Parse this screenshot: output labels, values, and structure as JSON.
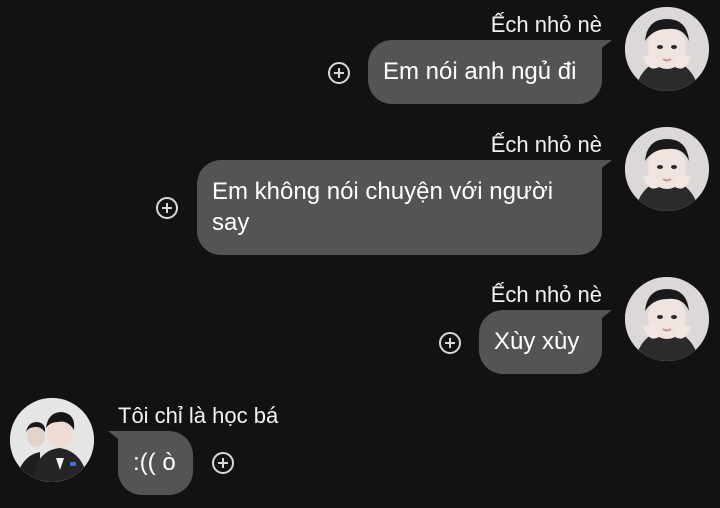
{
  "messages": [
    {
      "sender": "Ếch nhỏ nè",
      "text": "Em nói anh ngủ đi",
      "side": "right"
    },
    {
      "sender": "Ếch nhỏ nè",
      "text": "Em không nói chuyện với người say",
      "side": "right"
    },
    {
      "sender": "Ếch nhỏ nè",
      "text": "Xùy xùy",
      "side": "right"
    },
    {
      "sender": "Tôi chỉ là học bá",
      "text": ":(( ò",
      "side": "left"
    }
  ],
  "colors": {
    "background": "#121212",
    "bubble": "#545454",
    "text": "#ffffff",
    "icon": "#d9d9d9"
  },
  "icons": {
    "reaction": "add-reaction-icon",
    "avatar_right": "avatar-girl-hands-on-cheeks",
    "avatar_left": "avatar-boy-dark-suit"
  }
}
